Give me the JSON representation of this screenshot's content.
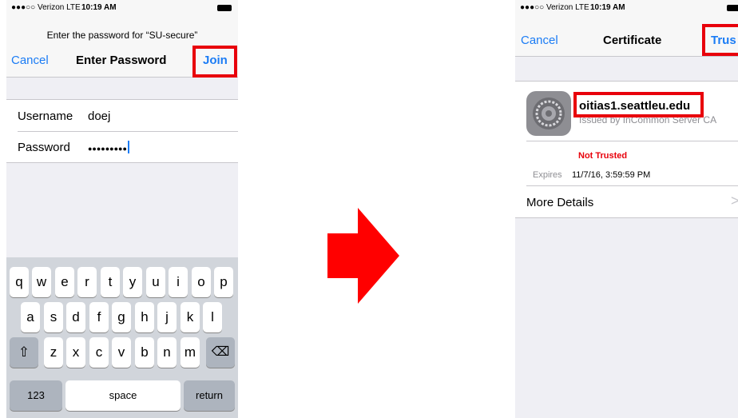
{
  "left_screen": {
    "status": {
      "carrier": "●●●○○ Verizon  LTE",
      "time": "10:19 AM"
    },
    "prompt": "Enter the password for “SU-secure”",
    "nav": {
      "cancel": "Cancel",
      "title": "Enter Password",
      "join": "Join"
    },
    "form": {
      "username_label": "Username",
      "username_value": "doej",
      "password_label": "Password",
      "password_value": "●●●●●●●●●"
    },
    "keyboard": {
      "row1": [
        "q",
        "w",
        "e",
        "r",
        "t",
        "y",
        "u",
        "i",
        "o",
        "p"
      ],
      "row2": [
        "a",
        "s",
        "d",
        "f",
        "g",
        "h",
        "j",
        "k",
        "l"
      ],
      "row3": [
        "z",
        "x",
        "c",
        "v",
        "b",
        "n",
        "m"
      ],
      "shift": "⇧",
      "delete": "⌫",
      "numbers": "123",
      "space": "space",
      "return": "return"
    }
  },
  "right_screen": {
    "status": {
      "carrier": "●●●○○ Verizon  LTE",
      "time": "10:19 AM"
    },
    "nav": {
      "cancel": "Cancel",
      "title": "Certificate",
      "trust": "Trus"
    },
    "certificate": {
      "hostname": "oitias1.seattleu.edu",
      "issued_by": "Issued by InCommon Server CA",
      "status": "Not Trusted",
      "expires_label": "Expires",
      "expires_value": "11/7/16, 3:59:59 PM",
      "more_details": "More Details",
      "chevron": ">"
    }
  },
  "colors": {
    "accent": "#1b7cf5",
    "highlight": "#e8000b",
    "arrow": "#ff0000"
  }
}
